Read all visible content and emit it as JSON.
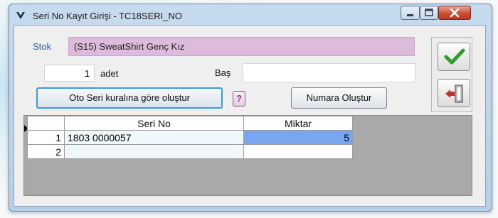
{
  "window": {
    "title": "Seri No Kayıt Girişi - TC18SERI_NO"
  },
  "form": {
    "stok_label": "Stok",
    "stok_value": "(S15) SweatShirt Genç Kız",
    "quantity": "1",
    "quantity_unit": "adet",
    "bas_label": "Baş",
    "bas_value": ""
  },
  "buttons": {
    "oto_seri": "Oto Seri kuralına göre oluştur",
    "help": "?",
    "numara_olustur": "Numara Oluştur",
    "confirm_icon": "green-checkmark-icon",
    "exit_icon": "exit-door-icon"
  },
  "grid": {
    "columns": [
      "Seri No",
      "Miktar"
    ],
    "rows": [
      {
        "num": "1",
        "seri_no": "1803  0000057",
        "miktar": "5"
      },
      {
        "num": "2",
        "seri_no": "",
        "miktar": ""
      }
    ]
  },
  "colors": {
    "stok_field_bg": "#ddbcdb",
    "selected_cell": "#79a6f0",
    "close_button": "#c94f35",
    "accent_border": "#3c9ad8"
  }
}
